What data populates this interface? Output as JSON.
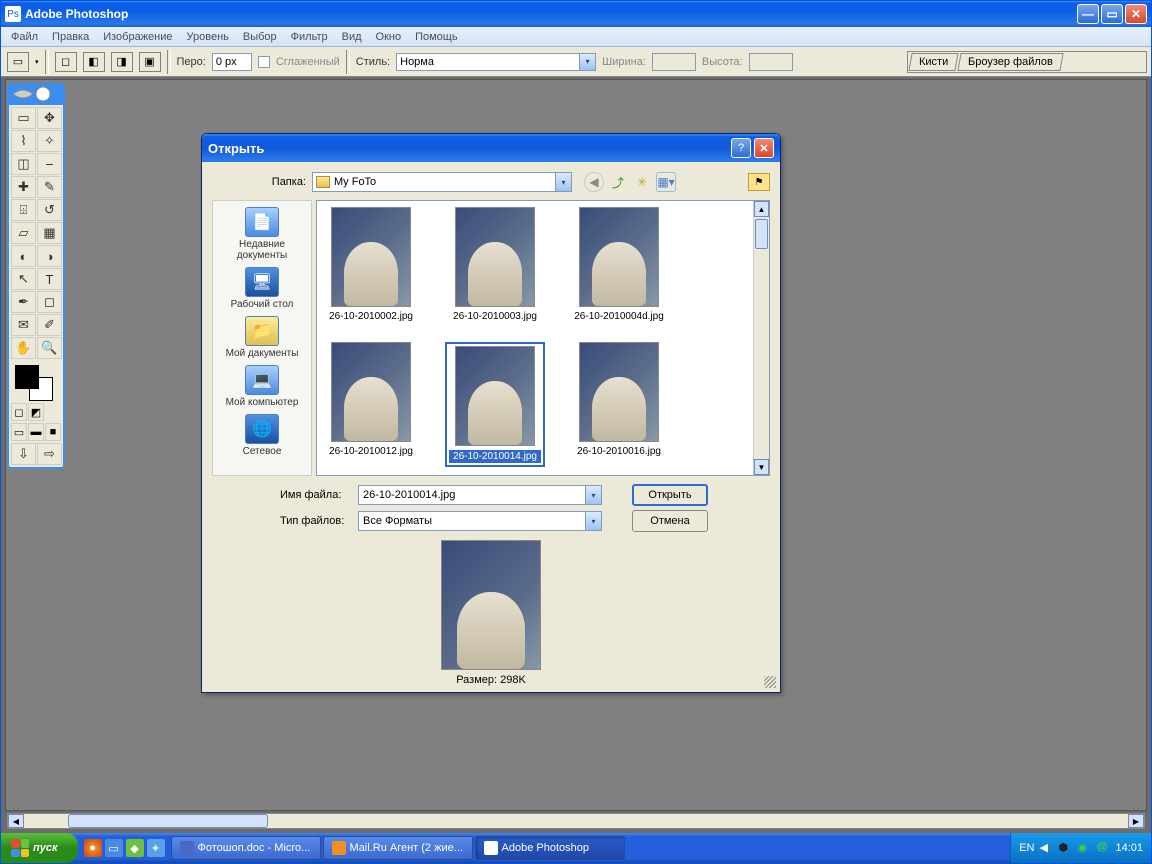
{
  "app": {
    "title": "Adobe Photoshop"
  },
  "menu": [
    "Файл",
    "Правка",
    "Изображение",
    "Уровень",
    "Выбор",
    "Фильтр",
    "Вид",
    "Окно",
    "Помощь"
  ],
  "options": {
    "pero_label": "Перо:",
    "pero_value": "0 px",
    "smoothed_label": "Сглаженный",
    "style_label": "Стиль:",
    "style_value": "Норма",
    "width_label": "Ширина:",
    "height_label": "Высота:"
  },
  "palettes": {
    "tab1": "Кисти",
    "tab2": "Броузер файлов"
  },
  "dialog": {
    "title": "Открыть",
    "folder_label": "Папка:",
    "folder_value": "My FoTo",
    "places": [
      "Недавние документы",
      "Рабочий стол",
      "Мой дакументы",
      "Мой компьютер",
      "Сетевое"
    ],
    "files": [
      "26-10-2010002.jpg",
      "26-10-2010003.jpg",
      "26-10-2010004d.jpg",
      "26-10-2010012.jpg",
      "26-10-2010014.jpg",
      "26-10-2010016.jpg"
    ],
    "selected_index": 4,
    "filename_label": "Имя файла:",
    "filename_value": "26-10-2010014.jpg",
    "filetype_label": "Тип файлов:",
    "filetype_value": "Все Форматы",
    "open_btn": "Открыть",
    "cancel_btn": "Отмена",
    "size_label": "Размер: 298K"
  },
  "taskbar": {
    "start": "пуск",
    "tasks": [
      {
        "label": "Фотошоп.doc - Micro...",
        "active": false
      },
      {
        "label": "Mail.Ru Агент (2 жие...",
        "active": false
      },
      {
        "label": "Adobe Photoshop",
        "active": true
      }
    ],
    "lang": "EN",
    "clock": "14:01"
  }
}
